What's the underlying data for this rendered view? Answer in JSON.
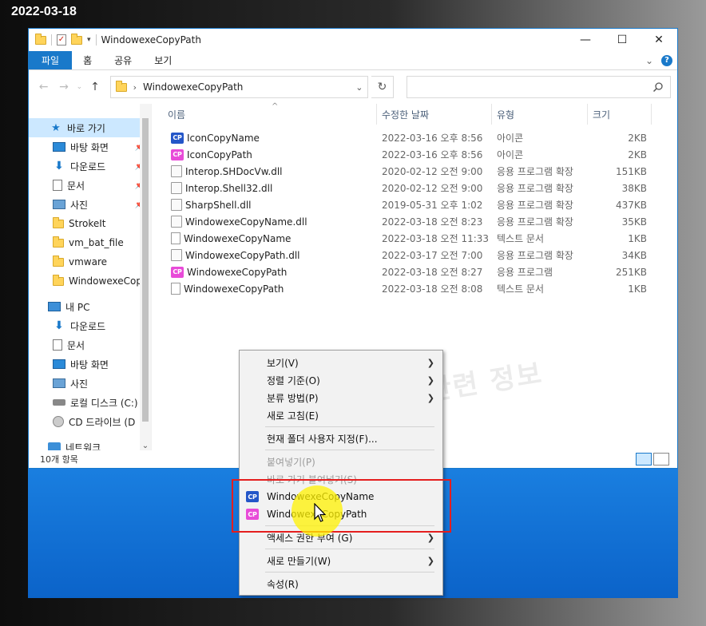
{
  "date_stamp": "2022-03-18",
  "window": {
    "title": "WindowexeCopyPath",
    "controls": {
      "minimize": "—",
      "maximize": "☐",
      "close": "✕"
    }
  },
  "ribbon": {
    "tabs": [
      "파일",
      "홈",
      "공유",
      "보기"
    ],
    "expand_glyph": "⌄",
    "help_glyph": "?"
  },
  "address": {
    "path": "WindowexeCopyPath",
    "search_placeholder": ""
  },
  "nav": {
    "quick_access": "바로 가기",
    "items": [
      {
        "label": "바탕 화면",
        "icon": "desktop-icon",
        "pinned": true
      },
      {
        "label": "다운로드",
        "icon": "download-icon",
        "pinned": true
      },
      {
        "label": "문서",
        "icon": "document-icon",
        "pinned": true
      },
      {
        "label": "사진",
        "icon": "pictures-icon",
        "pinned": true
      },
      {
        "label": "StrokeIt",
        "icon": "folder-icon",
        "pinned": false
      },
      {
        "label": "vm_bat_file",
        "icon": "folder-icon",
        "pinned": false
      },
      {
        "label": "vmware",
        "icon": "folder-icon",
        "pinned": false
      },
      {
        "label": "WindowexeCopy",
        "icon": "folder-icon",
        "pinned": false
      }
    ],
    "this_pc": "내 PC",
    "pc_items": [
      {
        "label": "다운로드",
        "icon": "download-icon"
      },
      {
        "label": "문서",
        "icon": "document-icon"
      },
      {
        "label": "바탕 화면",
        "icon": "desktop-icon"
      },
      {
        "label": "사진",
        "icon": "pictures-icon"
      },
      {
        "label": "로컬 디스크 (C:)",
        "icon": "drive-icon"
      },
      {
        "label": "CD 드라이브 (D",
        "icon": "cd-icon"
      }
    ],
    "network": "네트워크"
  },
  "columns": {
    "name": "이름",
    "date": "수정한 날짜",
    "type": "유형",
    "size": "크기"
  },
  "files": [
    {
      "name": "IconCopyName",
      "date": "2022-03-16 오후 8:56",
      "type": "아이콘",
      "size": "2KB",
      "icon": "cp-blue"
    },
    {
      "name": "IconCopyPath",
      "date": "2022-03-16 오후 8:56",
      "type": "아이콘",
      "size": "2KB",
      "icon": "cp-pink"
    },
    {
      "name": "Interop.SHDocVw.dll",
      "date": "2020-02-12 오전 9:00",
      "type": "응용 프로그램 확장",
      "size": "151KB",
      "icon": "dll"
    },
    {
      "name": "Interop.Shell32.dll",
      "date": "2020-02-12 오전 9:00",
      "type": "응용 프로그램 확장",
      "size": "38KB",
      "icon": "dll"
    },
    {
      "name": "SharpShell.dll",
      "date": "2019-05-31 오후 1:02",
      "type": "응용 프로그램 확장",
      "size": "437KB",
      "icon": "dll"
    },
    {
      "name": "WindowexeCopyName.dll",
      "date": "2022-03-18 오전 8:23",
      "type": "응용 프로그램 확장",
      "size": "35KB",
      "icon": "dll"
    },
    {
      "name": "WindowexeCopyName",
      "date": "2022-03-18 오전 11:33",
      "type": "텍스트 문서",
      "size": "1KB",
      "icon": "txt"
    },
    {
      "name": "WindowexeCopyPath.dll",
      "date": "2022-03-17 오전 7:00",
      "type": "응용 프로그램 확장",
      "size": "34KB",
      "icon": "dll"
    },
    {
      "name": "WindowexeCopyPath",
      "date": "2022-03-18 오전 8:27",
      "type": "응용 프로그램",
      "size": "251KB",
      "icon": "cp-pink"
    },
    {
      "name": "WindowexeCopyPath",
      "date": "2022-03-18 오전 8:08",
      "type": "텍스트 문서",
      "size": "1KB",
      "icon": "txt"
    }
  ],
  "watermark": "컴퓨터 관련 정보",
  "status": {
    "count": "10개 항목"
  },
  "context_menu": {
    "view": "보기(V)",
    "sort": "정렬 기준(O)",
    "group": "분류 방법(P)",
    "refresh": "새로 고침(E)",
    "customize": "현재 폴더 사용자 지정(F)...",
    "paste": "붙여넣기(P)",
    "paste_shortcut": "바로 가기 붙여넣기(S)",
    "copy_name": "WindowexeCopyName",
    "copy_path": "WindowexeCopyPath",
    "access": "액세스 권한 부여 (G)",
    "new": "새로 만들기(W)",
    "properties": "속성(R)"
  },
  "colors": {
    "accent": "#1979ca",
    "cp_blue": "#2456c8",
    "cp_pink": "#e84bd8",
    "highlight_border": "#e41e1e",
    "cursor_glow": "#fff200"
  }
}
